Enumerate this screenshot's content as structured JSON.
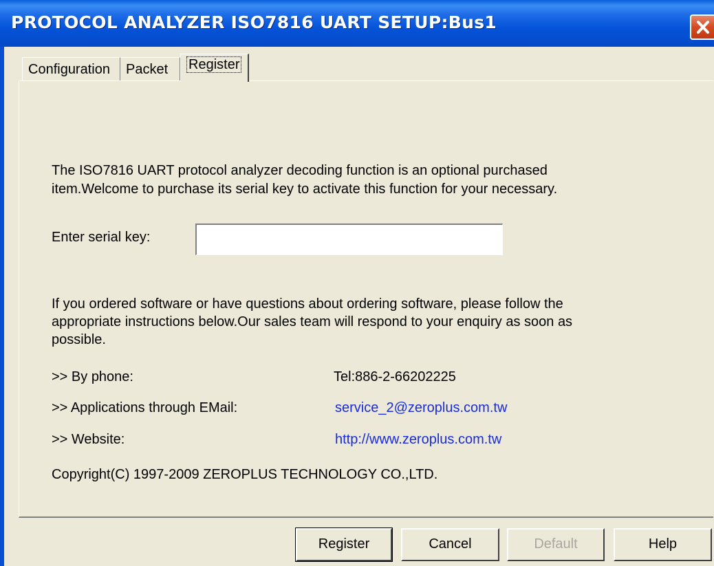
{
  "window": {
    "title": "PROTOCOL ANALYZER ISO7816 UART SETUP:Bus1"
  },
  "tabs": [
    {
      "label": "Configuration"
    },
    {
      "label": "Packet"
    },
    {
      "label": "Register"
    }
  ],
  "intro": {
    "line1": "The ISO7816 UART protocol analyzer decoding function is an optional purchased",
    "line2": "item.Welcome to purchase its serial key to activate this function for your necessary."
  },
  "serial": {
    "label": "Enter serial key:",
    "value": ""
  },
  "info": {
    "line1": "If you ordered software or have questions about ordering software, please follow the",
    "line2": "appropriate instructions below.Our sales team will respond to your enquiry as soon as",
    "line3": "possible."
  },
  "contacts": {
    "phone_label": ">> By phone:",
    "phone_value": "Tel:886-2-66202225",
    "email_label": ">> Applications through EMail:",
    "email_value": "service_2@zeroplus.com.tw",
    "website_label": ">> Website:",
    "website_value": "http://www.zeroplus.com.tw"
  },
  "copyright": "Copyright(C) 1997-2009 ZEROPLUS TECHNOLOGY CO.,LTD.",
  "buttons": {
    "register": "Register",
    "cancel": "Cancel",
    "default": "Default",
    "help": "Help"
  },
  "colors": {
    "titlebar": "#0553d8",
    "link": "#1a2cd6",
    "face": "#ece9d8",
    "close": "#d44a23"
  },
  "icons": {
    "close": "close-icon"
  }
}
